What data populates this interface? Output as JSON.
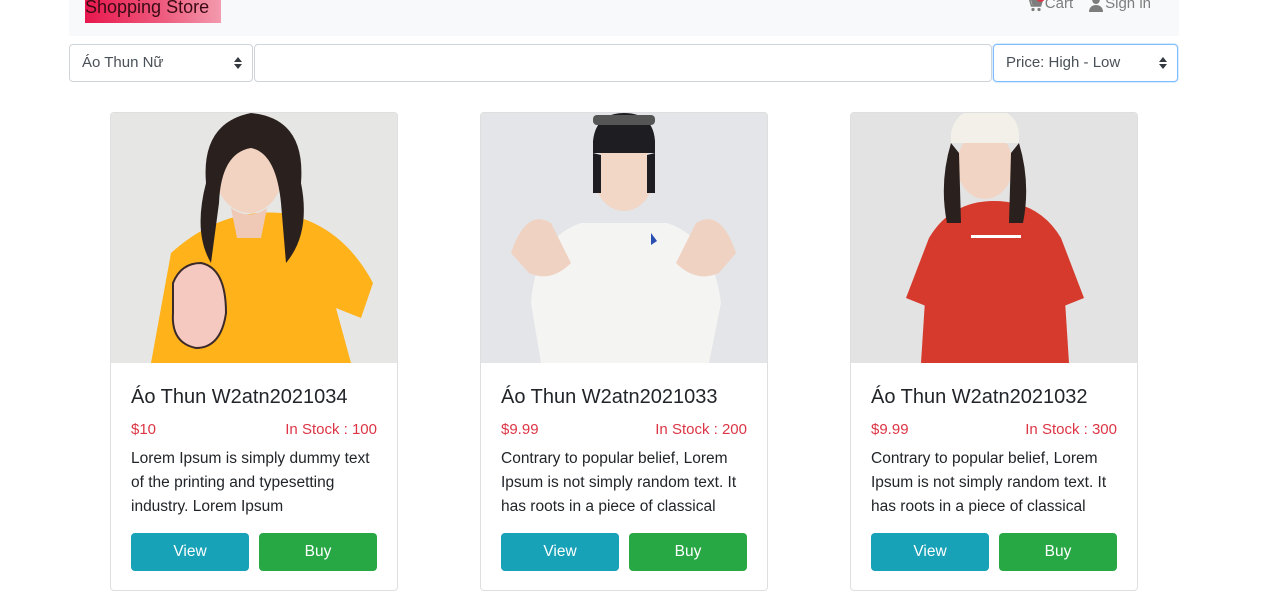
{
  "navbar": {
    "brand": "Shopping Store",
    "cart_label": "Cart",
    "signin_label": "Sign in",
    "brand_colors": [
      "#e8174e",
      "#f39aae"
    ]
  },
  "filters": {
    "category": "Áo Thun Nữ",
    "search_value": "",
    "sort": "Price: High - Low"
  },
  "products": [
    {
      "title": "Áo Thun W2atn2021034",
      "price": "$10",
      "stock": "In Stock : 100",
      "description": "Lorem Ipsum is simply dummy text of the printing and typesetting industry. Lorem Ipsum",
      "view_label": "View",
      "buy_label": "Buy",
      "shirt_color": "#ffb21a"
    },
    {
      "title": "Áo Thun W2atn2021033",
      "price": "$9.99",
      "stock": "In Stock : 200",
      "description": "Contrary to popular belief, Lorem Ipsum is not simply random text. It has roots in a piece of classical",
      "view_label": "View",
      "buy_label": "Buy",
      "shirt_color": "#f4f4f2"
    },
    {
      "title": "Áo Thun W2atn2021032",
      "price": "$9.99",
      "stock": "In Stock : 300",
      "description": "Contrary to popular belief, Lorem Ipsum is not simply random text. It has roots in a piece of classical",
      "view_label": "View",
      "buy_label": "Buy",
      "shirt_color": "#d63a2c"
    }
  ],
  "colors": {
    "view_button": "#17a2b8",
    "buy_button": "#28a745",
    "price_text": "#dc3545"
  }
}
